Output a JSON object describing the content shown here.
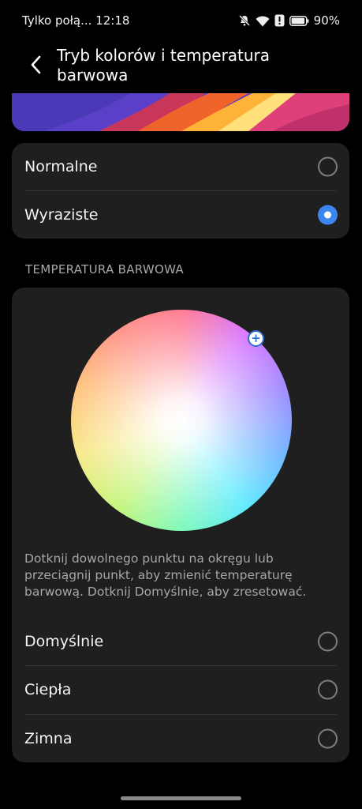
{
  "status_bar": {
    "carrier_time": "Tylko połą... 12:18",
    "battery_percent": "90%",
    "icons": [
      "bell-off-icon",
      "wifi-icon",
      "alert-icon",
      "battery-icon"
    ]
  },
  "header": {
    "title": "Tryb kolorów i temperatura barwowa",
    "back_icon": "chevron-left-icon"
  },
  "color_mode": {
    "options": [
      {
        "label": "Normalne",
        "selected": false
      },
      {
        "label": "Wyraziste",
        "selected": true
      }
    ]
  },
  "temperature": {
    "section_title": "TEMPERATURA BARWOWA",
    "hint": "Dotknij dowolnego punktu na okręgu lub przeciągnij punkt, aby zmienić temperaturę barwową. Dotknij Domyślnie, aby zresetować.",
    "handle_symbol": "+",
    "options": [
      {
        "label": "Domyślnie",
        "selected": false
      },
      {
        "label": "Ciepła",
        "selected": false
      },
      {
        "label": "Zimna",
        "selected": false
      }
    ]
  },
  "colors": {
    "accent": "#3d86f0",
    "card_bg": "#1f1f1f",
    "page_bg": "#000000"
  }
}
